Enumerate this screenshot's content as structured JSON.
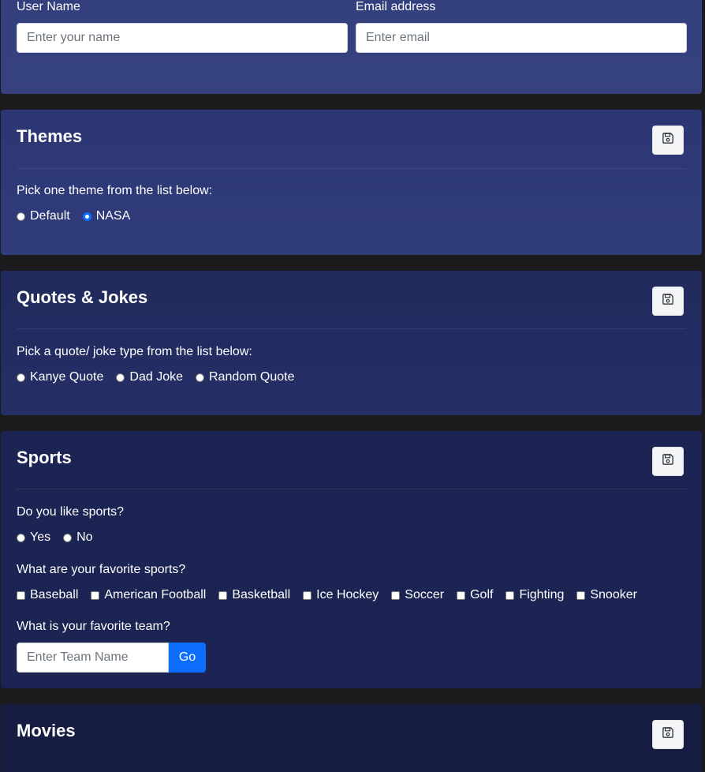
{
  "user": {
    "name_label": "User Name",
    "name_placeholder": "Enter your name",
    "name_value": "",
    "email_label": "Email address",
    "email_placeholder": "Enter email",
    "email_value": ""
  },
  "themes": {
    "title": "Themes",
    "prompt": "Pick one theme from the list below:",
    "options": [
      {
        "label": "Default",
        "checked": false
      },
      {
        "label": "NASA",
        "checked": true
      }
    ],
    "save_icon": "floppy-disk-icon"
  },
  "quotes": {
    "title": "Quotes & Jokes",
    "prompt": "Pick a quote/ joke type from the list below:",
    "options": [
      {
        "label": "Kanye Quote",
        "checked": false
      },
      {
        "label": "Dad Joke",
        "checked": false
      },
      {
        "label": "Random Quote",
        "checked": false
      }
    ],
    "save_icon": "floppy-disk-icon"
  },
  "sports": {
    "title": "Sports",
    "like_prompt": "Do you like sports?",
    "like_options": [
      {
        "label": "Yes",
        "checked": false
      },
      {
        "label": "No",
        "checked": false
      }
    ],
    "favorites_prompt": "What are your favorite sports?",
    "favorites": [
      {
        "label": "Baseball",
        "checked": false
      },
      {
        "label": "American Football",
        "checked": false
      },
      {
        "label": "Basketball",
        "checked": false
      },
      {
        "label": "Ice Hockey",
        "checked": false
      },
      {
        "label": "Soccer",
        "checked": false
      },
      {
        "label": "Golf",
        "checked": false
      },
      {
        "label": "Fighting",
        "checked": false
      },
      {
        "label": "Snooker",
        "checked": false
      }
    ],
    "team_prompt": "What is your favorite team?",
    "team_placeholder": "Enter Team Name",
    "team_value": "",
    "go_label": "Go",
    "save_icon": "floppy-disk-icon"
  },
  "movies": {
    "title": "Movies",
    "save_icon": "floppy-disk-icon"
  },
  "colors": {
    "page_background": "#1b1b1d",
    "accent": "#0d6efd",
    "text": "#ffffff"
  }
}
